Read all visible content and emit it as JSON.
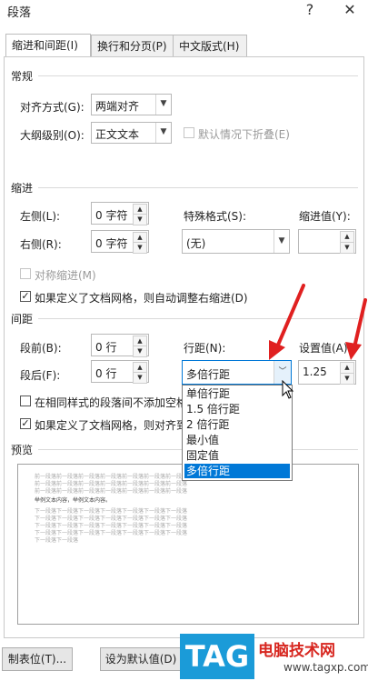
{
  "window": {
    "title": "段落",
    "help_label": "?",
    "close_label": "✕"
  },
  "tabs": [
    {
      "label": "缩进和间距(I)"
    },
    {
      "label": "换行和分页(P)"
    },
    {
      "label": "中文版式(H)"
    }
  ],
  "general": {
    "heading": "常规",
    "alignment_label": "对齐方式(G):",
    "alignment_value": "两端对齐",
    "outline_label": "大纲级别(O):",
    "outline_value": "正文文本",
    "collapse_label": "默认情况下折叠(E)"
  },
  "indent": {
    "heading": "缩进",
    "left_label": "左侧(L):",
    "left_value": "0 字符",
    "right_label": "右侧(R):",
    "right_value": "0 字符",
    "special_label": "特殊格式(S):",
    "special_value": "(无)",
    "by_label": "缩进值(Y):",
    "by_value": "",
    "mirror_label": "对称缩进(M)",
    "auto_adjust_label": "如果定义了文档网格，则自动调整右缩进(D)"
  },
  "spacing": {
    "heading": "间距",
    "before_label": "段前(B):",
    "before_value": "0 行",
    "after_label": "段后(F):",
    "after_value": "0 行",
    "line_label": "行距(N):",
    "line_value": "多倍行距",
    "at_label": "设置值(A):",
    "at_value": "1.25",
    "no_space_label": "在相同样式的段落间不添加空格",
    "snap_label": "如果定义了文档网格，则对齐到"
  },
  "line_spacing_options": [
    "单倍行距",
    "1.5 倍行距",
    "2 倍行距",
    "最小值",
    "固定值",
    "多倍行距"
  ],
  "preview": {
    "heading": "预览",
    "prev_text": "前一段落前一段落前一段落前一段落前一段落前一段落前一段落",
    "sample_text": "举例文本内容，举例文本内容。",
    "next_text": "下一段落下一段落下一段落下一段落下一段落下一段落下一段落",
    "next_short": "下一段落下一段落"
  },
  "buttons": {
    "tabs": "制表位(T)...",
    "default": "设为默认值(D)"
  },
  "watermark": {
    "logo": "TAG",
    "site_name": "电脑技术网",
    "url": "www.tagxp.com"
  },
  "colors": {
    "accent": "#0078d7",
    "arrow": "#e02020"
  }
}
